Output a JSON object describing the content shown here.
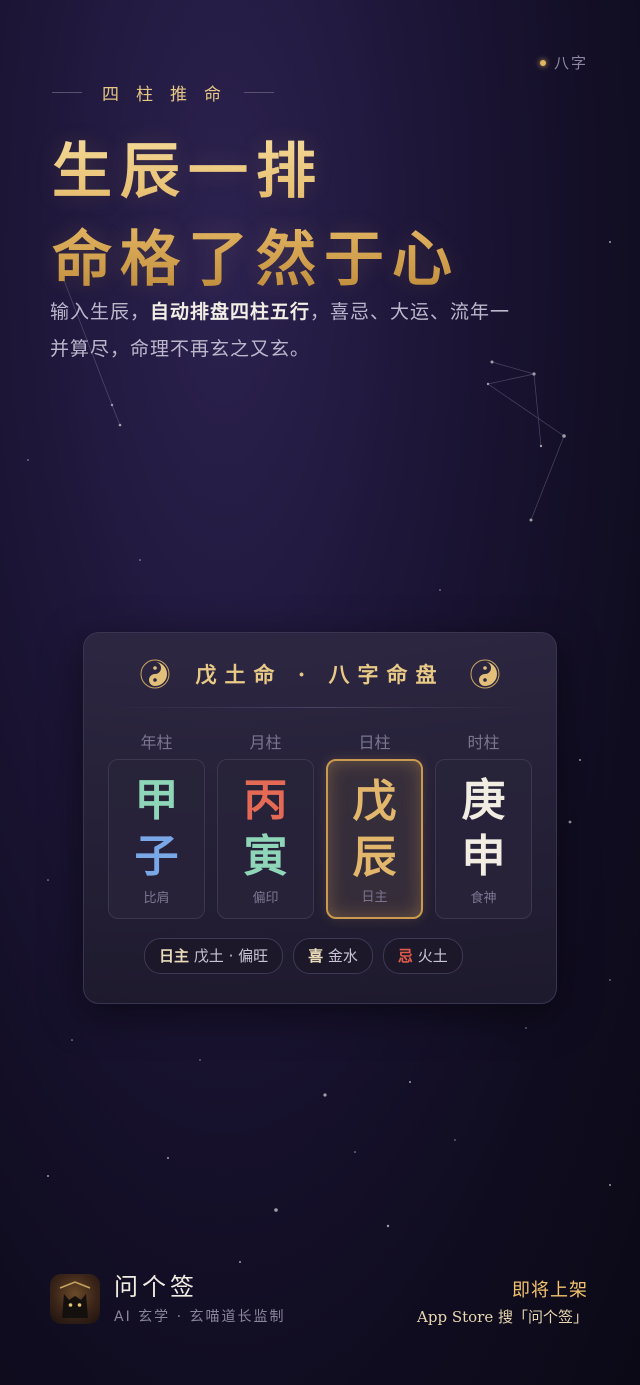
{
  "top_tag": "八字",
  "kicker": "四柱推命",
  "headline": [
    "生辰一排",
    "命格了然于心"
  ],
  "description": {
    "part1": "输入生辰，",
    "bold": "自动排盘四柱五行",
    "part2": "，喜忌、大运、流年一并算尽，命理不再玄之又玄。"
  },
  "card": {
    "title": "戊土命 · 八字命盘",
    "pillars": [
      {
        "label": "年柱",
        "gan": "甲",
        "zhi": "子",
        "shishen": "比肩",
        "gan_color": "#8fd6b8",
        "zhi_color": "#7aa7e6",
        "active": false
      },
      {
        "label": "月柱",
        "gan": "丙",
        "zhi": "寅",
        "shishen": "偏印",
        "gan_color": "#e56a55",
        "zhi_color": "#8fd6b8",
        "active": false
      },
      {
        "label": "日柱",
        "gan": "戊",
        "zhi": "辰",
        "shishen": "日主",
        "gan_color": "#e2b76c",
        "zhi_color": "#e2b76c",
        "active": true
      },
      {
        "label": "时柱",
        "gan": "庚",
        "zhi": "申",
        "shishen": "食神",
        "gan_color": "#f2ede2",
        "zhi_color": "#f2ede2",
        "active": false
      }
    ],
    "tags": [
      {
        "key": "日主",
        "value": "戊土 · 偏旺"
      },
      {
        "key": "喜",
        "value": "金水"
      },
      {
        "key": "忌",
        "value": "火土"
      }
    ]
  },
  "footer": {
    "brand": "问个签",
    "subtitle": "AI 玄学 · 玄喵道长监制",
    "coming_soon": "即将上架",
    "store_hint": "App Store 搜「问个签」"
  },
  "colors": {
    "gold": "#e6c783",
    "background": "#120e24",
    "red": "#e05b4a"
  }
}
